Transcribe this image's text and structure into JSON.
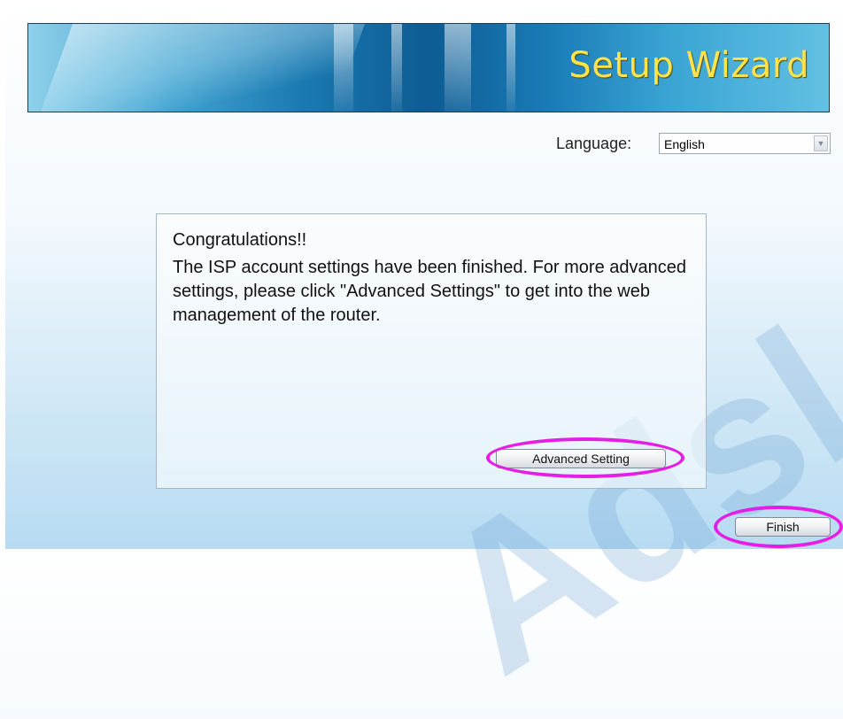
{
  "banner": {
    "title": "Setup Wizard"
  },
  "language": {
    "label": "Language:",
    "selected": "English"
  },
  "message": {
    "title": "Congratulations!!",
    "body": "The ISP account settings have been finished. For more advanced settings, please click \"Advanced Settings\" to get into the web management of the router."
  },
  "buttons": {
    "advanced": "Advanced Setting",
    "finish": "Finish"
  },
  "watermark": "Adsl",
  "colors": {
    "title": "#ffe34d",
    "highlight": "#e51ee5",
    "background": "#cfe7f6"
  }
}
